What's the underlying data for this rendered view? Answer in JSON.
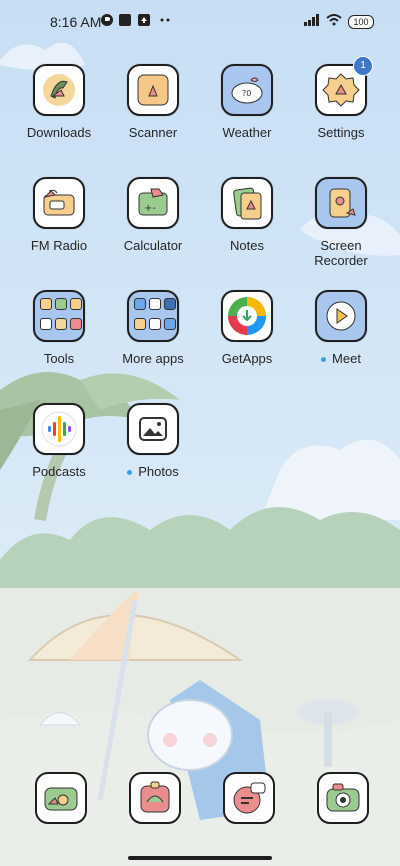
{
  "status_bar": {
    "time": "8:16 AM",
    "battery": "100"
  },
  "apps": [
    {
      "label": "Downloads"
    },
    {
      "label": "Scanner"
    },
    {
      "label": "Weather"
    },
    {
      "label": "Settings",
      "badge": "1"
    },
    {
      "label": "FM Radio"
    },
    {
      "label": "Calculator"
    },
    {
      "label": "Notes"
    },
    {
      "label": "Screen\nRecorder"
    },
    {
      "label": "Tools"
    },
    {
      "label": "More apps"
    },
    {
      "label": "GetApps"
    },
    {
      "label": "Meet"
    },
    {
      "label": "Podcasts"
    },
    {
      "label": "Photos"
    }
  ],
  "dock": [
    "phone-app",
    "gallery-app",
    "messaging-app",
    "camera-app"
  ],
  "colors": {
    "sky": "#c9e0f6",
    "icon_blue": "#a9c6ef",
    "badge": "#3f78c9",
    "new_dot": "#3aa0e6"
  }
}
